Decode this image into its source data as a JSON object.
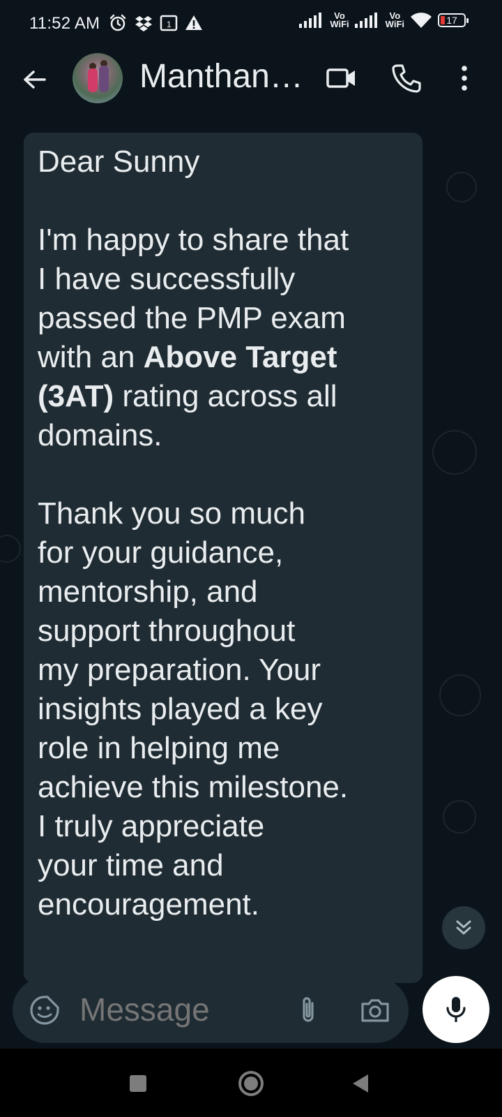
{
  "status_bar": {
    "time": "11:52 AM",
    "left_icons": [
      "alarm-icon",
      "dropbox-icon",
      "sim-icon",
      "warning-icon"
    ],
    "vo_wifi_1": {
      "top": "Vo",
      "bottom": "WiFi"
    },
    "vo_wifi_2": {
      "top": "Vo",
      "bottom": "WiFi"
    },
    "battery_level": "17",
    "battery_color": "#e53935"
  },
  "header": {
    "contact_name": "Manthan…",
    "icons": [
      "back-arrow-icon",
      "video-call-icon",
      "voice-call-icon",
      "more-options-icon"
    ]
  },
  "message": {
    "greeting": "Dear Sunny",
    "para1_line1": "I'm happy to share that",
    "para1_line2": "I have successfully",
    "para1_line3": "passed the PMP exam",
    "para1_line4_pre": "with an ",
    "para1_bold_1": "Above Target",
    "para1_bold_2": "(3AT)",
    "para1_line5_post": " rating across all",
    "para1_line6": "domains.",
    "para2_line1": "Thank you so much",
    "para2_line2": "for your guidance,",
    "para2_line3": "mentorship, and",
    "para2_line4": "support throughout",
    "para2_line5": "my preparation. Your",
    "para2_line6": "insights played a key",
    "para2_line7": "role in helping me",
    "para2_line8": "achieve this milestone.",
    "para2_line9": "I truly appreciate",
    "para2_line10": "your time and",
    "para2_line11": "encouragement."
  },
  "composer": {
    "placeholder": "Message",
    "icons": [
      "sticker-icon",
      "attach-icon",
      "camera-icon",
      "mic-icon"
    ]
  },
  "colors": {
    "background": "#0b141a",
    "bubble": "#202c33",
    "composer": "#1f2c33",
    "text": "#e9edef",
    "muted": "#8696a0"
  }
}
